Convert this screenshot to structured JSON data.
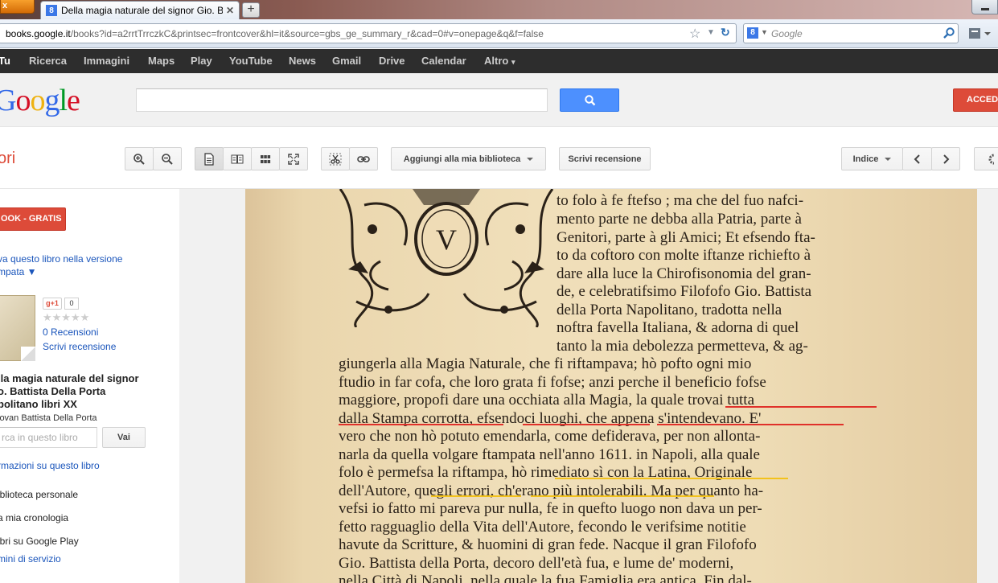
{
  "browser": {
    "app_button": "x",
    "tab_title": "Della magia naturale del signor Gio. Batti...",
    "url_host": "books.google.it",
    "url_path": "/books?id=a2rrtTrrczkC&printsec=frontcover&hl=it&source=gbs_ge_summary_r&cad=0#v=onepage&q&f=false",
    "url_prefix": "",
    "search_placeholder": "Google"
  },
  "gbar": {
    "items": [
      "Tu",
      "Ricerca",
      "Immagini",
      "Maps",
      "Play",
      "YouTube",
      "News",
      "Gmail",
      "Drive",
      "Calendar",
      "Altro"
    ]
  },
  "header": {
    "logo": "Google",
    "signin_label": "ACCEDI"
  },
  "toolbar": {
    "section_title": "ori",
    "add_library_label": "Aggiungi alla mia biblioteca",
    "write_review_label": "Scrivi recensione",
    "index_label": "Indice"
  },
  "sidebar": {
    "get_book_label": "OOK - GRATIS",
    "print_link_1": "va questo libro nella versione",
    "print_link_2": "mpata ▼",
    "gplus_label": "g+1",
    "gplus_count": "0",
    "reviews_count": "0 Recensioni",
    "write_review": "Scrivi recensione",
    "book_title_lines": [
      "lla magia naturale del signor",
      "o. Battista Della Porta",
      "politano libri XX"
    ],
    "author": "iovan Battista Della Porta",
    "in_book_placeholder": "rca in questo libro",
    "go_label": "Vai",
    "info_link": "rmazioni su questo libro",
    "menu": [
      "iblioteca personale",
      "a mia cronologia",
      "ibri su Google Play"
    ],
    "terms_link": "mini di servizio"
  },
  "book_page": {
    "initial": "V",
    "lines": [
      "to folo à fe ftefso ; ma che del fuo nafci-",
      "mento parte ne debba alla Patria, parte à",
      "Genitori, parte à gli Amici; Et efsendo fta-",
      "to da coftoro con molte iftanze richiefto à",
      "dare alla luce la Chirofisonomia del gran-",
      "de, e celebratifsimo Filofofo Gio. Battista",
      "della Porta Napolitano, tradotta nella",
      "noftra favella Italiana, & adorna di quel",
      "tanto la mia debolezza permetteva, & ag-",
      "giungerla alla Magia Naturale, che fi riftampava; hò pofto ogni mio",
      "ftudio in far cofa, che loro grata fi fofse; anzi perche il beneficio fofse",
      "maggiore, propofi dare una occhiata alla Magia, la quale trovai tutta",
      "dalla Stampa corrotta, efsendoci luoghi, che appena s'intendevano. E'",
      "vero che non hò potuto emendarla, come defiderava, per non allonta-",
      "narla da quella volgare ftampata nell'anno 1611. in Napoli, alla quale",
      "folo è permefsa la riftampa, hò rimediato sì con la Latina, Originale",
      "dell'Autore, quegli errori, ch'erano più intolerabili. Ma per quanto ha-",
      "vefsi io fatto mi pareva pur nulla, fe in quefto luogo non dava un per-",
      "fetto ragguaglio della Vita dell'Autore, fecondo le verifsime notitie",
      "havute da Scritture, & huomini di gran fede. Nacque il gran Filofofo",
      "Gio. Battista della Porta, decoro dell'età fua, e lume de' moderni,",
      "nella Città di Napoli, nella quale la fua Famiglia era antica. Fin dal-"
    ]
  },
  "colors": {
    "accent_red": "#dd4b39",
    "search_blue": "#4d90fe",
    "link_blue": "#1a55bb",
    "underline_red": "#e0312a",
    "underline_yellow": "#f3c21c"
  }
}
